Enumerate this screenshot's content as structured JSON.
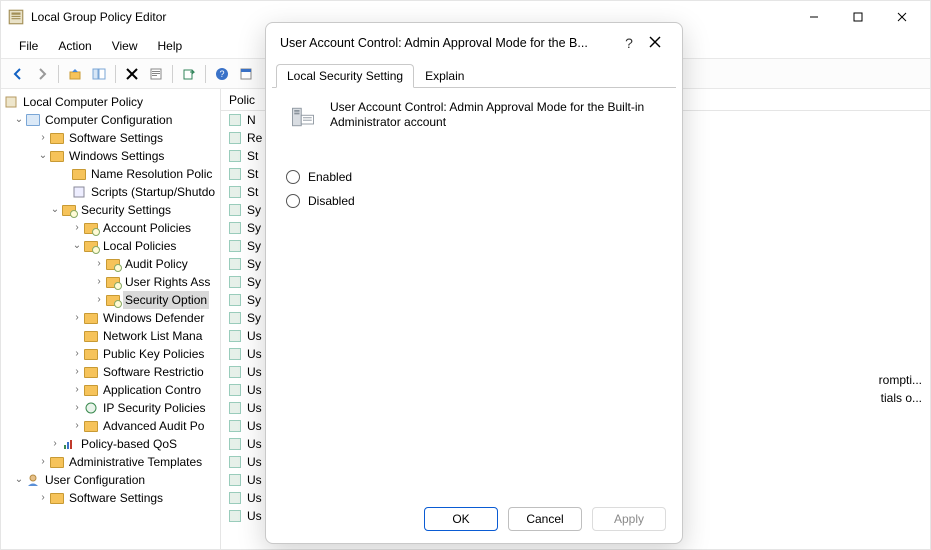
{
  "window": {
    "title": "Local Group Policy Editor"
  },
  "menu": {
    "file": "File",
    "action": "Action",
    "view": "View",
    "help": "Help"
  },
  "tree": {
    "root": "Local Computer Policy",
    "comp_config": "Computer Configuration",
    "software_settings": "Software Settings",
    "windows_settings": "Windows Settings",
    "name_resolution": "Name Resolution Polic",
    "scripts": "Scripts (Startup/Shutdo",
    "security_settings": "Security Settings",
    "account_policies": "Account Policies",
    "local_policies": "Local Policies",
    "audit_policy": "Audit Policy",
    "user_rights": "User Rights Ass",
    "security_options": "Security Option",
    "windows_defender": "Windows Defender",
    "network_list": "Network List Mana",
    "public_key": "Public Key Policies",
    "software_restriction": "Software Restrictio",
    "app_control": "Application Contro",
    "ip_security": "IP Security Policies",
    "advanced_audit": "Advanced Audit Po",
    "policy_qos": "Policy-based QoS",
    "admin_templates": "Administrative Templates",
    "user_config": "User Configuration",
    "software_settings2": "Software Settings"
  },
  "list": {
    "header": "Polic",
    "rows": [
      "N",
      "Re",
      "St",
      "St",
      "St",
      "Sy",
      "Sy",
      "Sy",
      "Sy",
      "Sy",
      "Sy",
      "Sy",
      "Us",
      "Us",
      "Us",
      "Us",
      "Us",
      "Us",
      "Us",
      "Us",
      "Us",
      "Us",
      "Us"
    ],
    "right_frag1": "rompti...",
    "right_frag2": "tials o..."
  },
  "dialog": {
    "title": "User Account Control: Admin Approval Mode for the B...",
    "tab_setting": "Local Security Setting",
    "tab_explain": "Explain",
    "policy_name": "User Account Control: Admin Approval Mode for the Built-in Administrator account",
    "opt_enabled": "Enabled",
    "opt_disabled": "Disabled",
    "btn_ok": "OK",
    "btn_cancel": "Cancel",
    "btn_apply": "Apply",
    "help": "?"
  }
}
